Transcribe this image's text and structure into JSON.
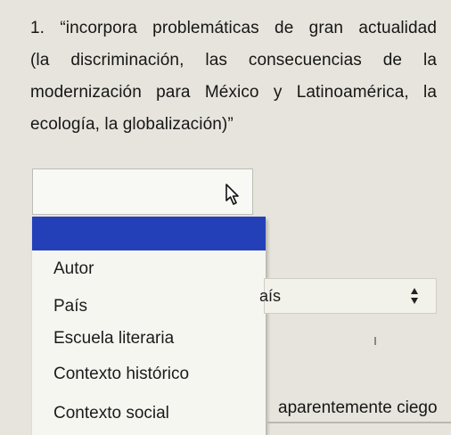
{
  "question": {
    "line1": "1. “incorpora problemáticas de gran actualidad",
    "line2": "(la discriminación, las consecuencias de la",
    "line3": "modernización para México y Latinoamérica, la",
    "line4": "ecología, la globalización)”"
  },
  "dropdown": {
    "options": [
      "Autor",
      "País",
      "Escuela literaria",
      "Contexto histórico",
      "Contexto social"
    ],
    "highlight_color": "#2440b8"
  },
  "second_select": {
    "value": "aís"
  },
  "trailing_text": "aparentemente ciego",
  "icons": {
    "cursor": "mouse-pointer-icon",
    "select_arrows": "up-down-arrows-icon"
  }
}
